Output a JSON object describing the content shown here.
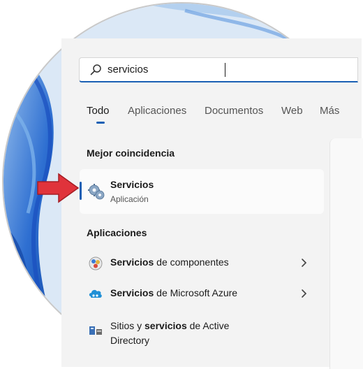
{
  "search": {
    "value": "servicios"
  },
  "tabs": [
    {
      "label": "Todo",
      "active": true
    },
    {
      "label": "Aplicaciones"
    },
    {
      "label": "Documentos"
    },
    {
      "label": "Web"
    },
    {
      "label": "Más"
    }
  ],
  "best_match": {
    "section_title": "Mejor coincidencia",
    "name": "Servicios",
    "type": "Aplicación",
    "icon": "services-gear-icon"
  },
  "apps": {
    "section_title": "Aplicaciones",
    "items": [
      {
        "bold": "Servicios",
        "rest": " de componentes",
        "icon": "component-services-icon",
        "chevron": true
      },
      {
        "bold": "Servicios",
        "rest": " de Microsoft Azure",
        "icon": "azure-services-icon",
        "chevron": true
      },
      {
        "pre": "Sitios y ",
        "bold": "servicios",
        "rest": " de Active",
        "line2": "Directory",
        "icon": "active-directory-icon",
        "chevron": false
      }
    ]
  },
  "colors": {
    "accent": "#1a5fb4",
    "arrow": "#e0333b"
  }
}
